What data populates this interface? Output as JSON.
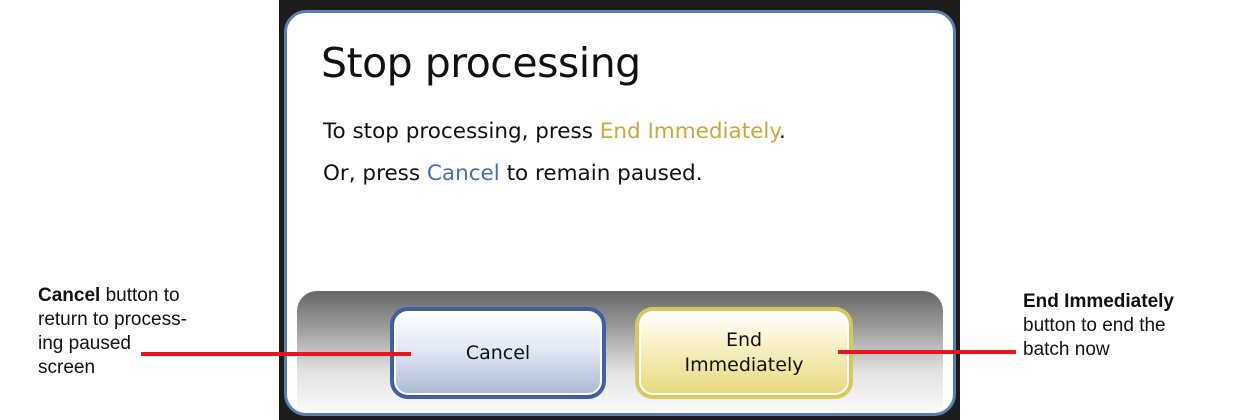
{
  "dialog": {
    "title": "Stop processing",
    "line1_prefix": "To stop processing, press ",
    "line1_highlight": "End Immediately",
    "line1_suffix": ".",
    "line2_prefix": "Or, press ",
    "line2_highlight": "Cancel",
    "line2_suffix": " to remain paused.",
    "cancel_label": "Cancel",
    "end_label_line1": "End",
    "end_label_line2": "Immediately"
  },
  "annotations": {
    "cancel": {
      "bold": "Cancel",
      "text_a": " button to",
      "text_b": "return to process-",
      "text_c": "ing paused",
      "text_d": "screen"
    },
    "end": {
      "bold": "End Immediately",
      "text_a": "button to end the",
      "text_b": "batch now"
    }
  },
  "colors": {
    "dialog_border": "#5a7fb4",
    "end_highlight_text": "#c9a83c",
    "cancel_highlight_text": "#4a6fb5",
    "leader_line": "#e8141e"
  }
}
